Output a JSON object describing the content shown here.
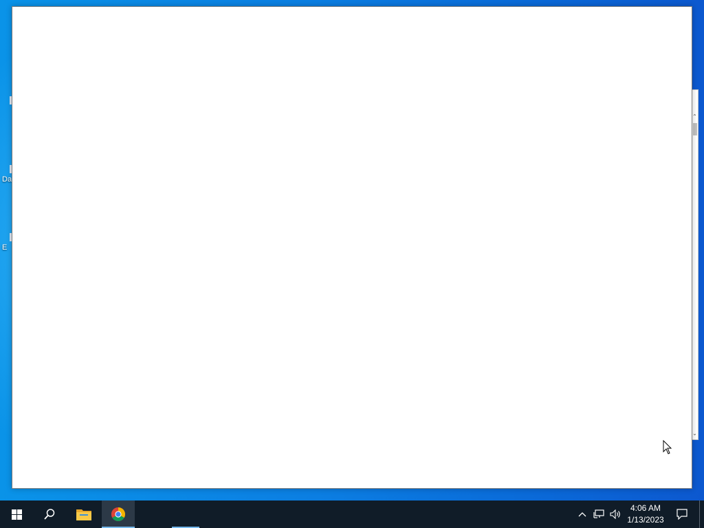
{
  "desktop": {
    "icons": [
      {
        "name": "desktop-icon-1",
        "label": ""
      },
      {
        "name": "desktop-icon-2",
        "label": "Da"
      },
      {
        "name": "desktop-icon-3",
        "label": "E"
      }
    ]
  },
  "taskbar": {
    "start_icon": "windows-logo-icon",
    "search_icon": "search-icon",
    "pinned": [
      {
        "name": "file-explorer",
        "icon": "folder-icon"
      },
      {
        "name": "google-chrome",
        "icon": "chrome-icon",
        "active": true
      }
    ],
    "tray": {
      "chevron_icon": "chevron-up-icon",
      "network_icon": "network-icon",
      "volume_icon": "volume-icon",
      "notification_icon": "notification-icon"
    },
    "clock": {
      "time": "4:06 AM",
      "date": "1/13/2023"
    }
  },
  "colors": {
    "taskbar": "#101c28",
    "accent": "#76b9ed",
    "desktop": "#0b7ee2"
  }
}
